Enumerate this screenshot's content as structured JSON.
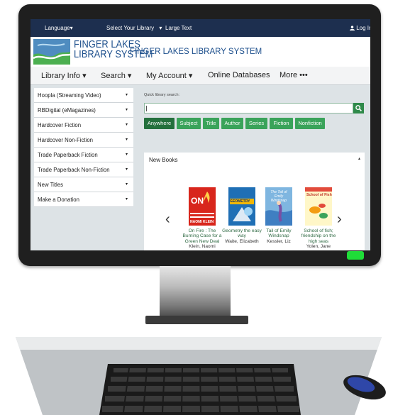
{
  "topbar": {
    "language": "Language▾",
    "select_library": "Select Your Library",
    "select_library_caret": "▾",
    "large_text": "Large Text",
    "login": "Log In",
    "login_icon": "user-icon"
  },
  "header": {
    "logo_line1": "FINGER LAKES",
    "logo_line2": "LIBRARY SYSTEM",
    "site_title": "FINGER LAKES LIBRARY SYSTEM"
  },
  "menu": {
    "library_info": "Library Info ▾",
    "search": "Search ▾",
    "my_account": "My Account ▾",
    "online_databases": "Online Databases",
    "more": "More •••"
  },
  "sidebar": {
    "items": [
      {
        "label": "Hoopla (Streaming Video)"
      },
      {
        "label": "RBDigital (eMagazines)"
      },
      {
        "label": "Hardcover Fiction"
      },
      {
        "label": "Hardcover Non-Fiction"
      },
      {
        "label": "Trade Paperback Fiction"
      },
      {
        "label": "Trade Paperback Non-Fiction"
      },
      {
        "label": "New Titles"
      },
      {
        "label": "Make a Donation"
      }
    ],
    "caret": "▾"
  },
  "quick_search": {
    "label": "Quick library search:",
    "value": "",
    "filters": [
      "Anywhere",
      "Subject",
      "Title",
      "Author",
      "Series",
      "Fiction",
      "Nonfiction"
    ],
    "active_filter": "Anywhere"
  },
  "new_books": {
    "title": "New Books",
    "collapse_caret": "▴",
    "prev": "‹",
    "next": "›",
    "books": [
      {
        "title": "On Fire : The Burning Case for a Green New Deal",
        "author": "Klein, Naomi",
        "cover_title": "ON",
        "cover_author": "NAOMI KLEIN"
      },
      {
        "title": "Geometry the easy way",
        "author": "Waite, Elizabeth",
        "cover_title": "GEOMETRY"
      },
      {
        "title": "Tail of Emily Windsnap",
        "author": "Kessler, Liz",
        "cover_title": "The Tail of Emily Windsnap"
      },
      {
        "title": "School of fish; friendship on the high seas",
        "author": "Yolen, Jane",
        "cover_title": "School of Fish"
      }
    ]
  },
  "colors": {
    "topbar": "#1d2f4f",
    "brand_blue": "#1d4f8c",
    "button_green": "#3aa35a",
    "button_green_active": "#24703d",
    "power_led": "#1fdc38"
  }
}
